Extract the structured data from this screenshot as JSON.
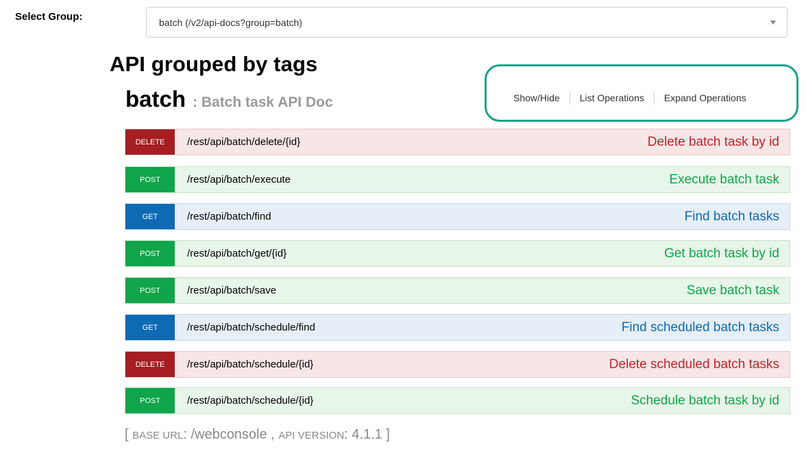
{
  "group": {
    "label": "Select Group:",
    "selected": "batch (/v2/api-docs?group=batch)"
  },
  "page_title": "API grouped by tags",
  "tag": {
    "name": "batch",
    "description": ": Batch task API Doc"
  },
  "operation_links": {
    "show_hide": "Show/Hide",
    "list": "List Operations",
    "expand": "Expand Operations"
  },
  "operations": [
    {
      "method": "DELETE",
      "path": "/rest/api/batch/delete/{id}",
      "summary": "Delete batch task by id"
    },
    {
      "method": "POST",
      "path": "/rest/api/batch/execute",
      "summary": "Execute batch task"
    },
    {
      "method": "GET",
      "path": "/rest/api/batch/find",
      "summary": "Find batch tasks"
    },
    {
      "method": "POST",
      "path": "/rest/api/batch/get/{id}",
      "summary": "Get batch task by id"
    },
    {
      "method": "POST",
      "path": "/rest/api/batch/save",
      "summary": "Save batch task"
    },
    {
      "method": "GET",
      "path": "/rest/api/batch/schedule/find",
      "summary": "Find scheduled batch tasks"
    },
    {
      "method": "DELETE",
      "path": "/rest/api/batch/schedule/{id}",
      "summary": "Delete scheduled batch tasks"
    },
    {
      "method": "POST",
      "path": "/rest/api/batch/schedule/{id}",
      "summary": "Schedule batch task by id"
    }
  ],
  "base_info": {
    "open": "[ ",
    "base_url_label": "BASE URL",
    "base_url_value": ": /webconsole , ",
    "api_version_label": "API VERSION",
    "api_version_value": ": 4.1.1 ]"
  },
  "colors": {
    "delete": "#a41e22",
    "post": "#10a54a",
    "get": "#0f6ab4",
    "highlight": "#1aa28a"
  }
}
